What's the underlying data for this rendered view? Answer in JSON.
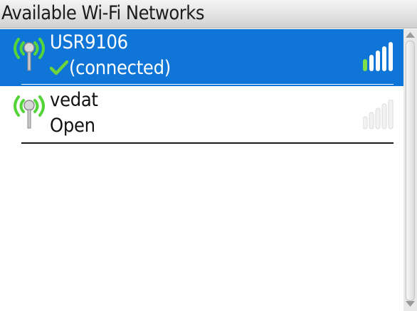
{
  "header": {
    "title": "Available Wi-Fi Networks"
  },
  "networks": [
    {
      "name": "USR9106",
      "status": "(connected)",
      "selected": true,
      "connected": true,
      "signal_bars_active": 5
    },
    {
      "name": "vedat",
      "status": "Open",
      "selected": false,
      "connected": false,
      "signal_bars_active": 0
    }
  ],
  "colors": {
    "selection": "#0f76d8",
    "antenna_waves": "#55d43a",
    "check": "#6dd43c",
    "signal_active": "#ffffff",
    "signal_inactive": "#e8e8e8"
  },
  "icons": {
    "antenna": "wifi-antenna-icon",
    "connected": "checkmark-icon",
    "signal": "signal-strength-icon",
    "scroll_up": "arrow-up-icon",
    "scroll_down": "arrow-down-icon"
  }
}
